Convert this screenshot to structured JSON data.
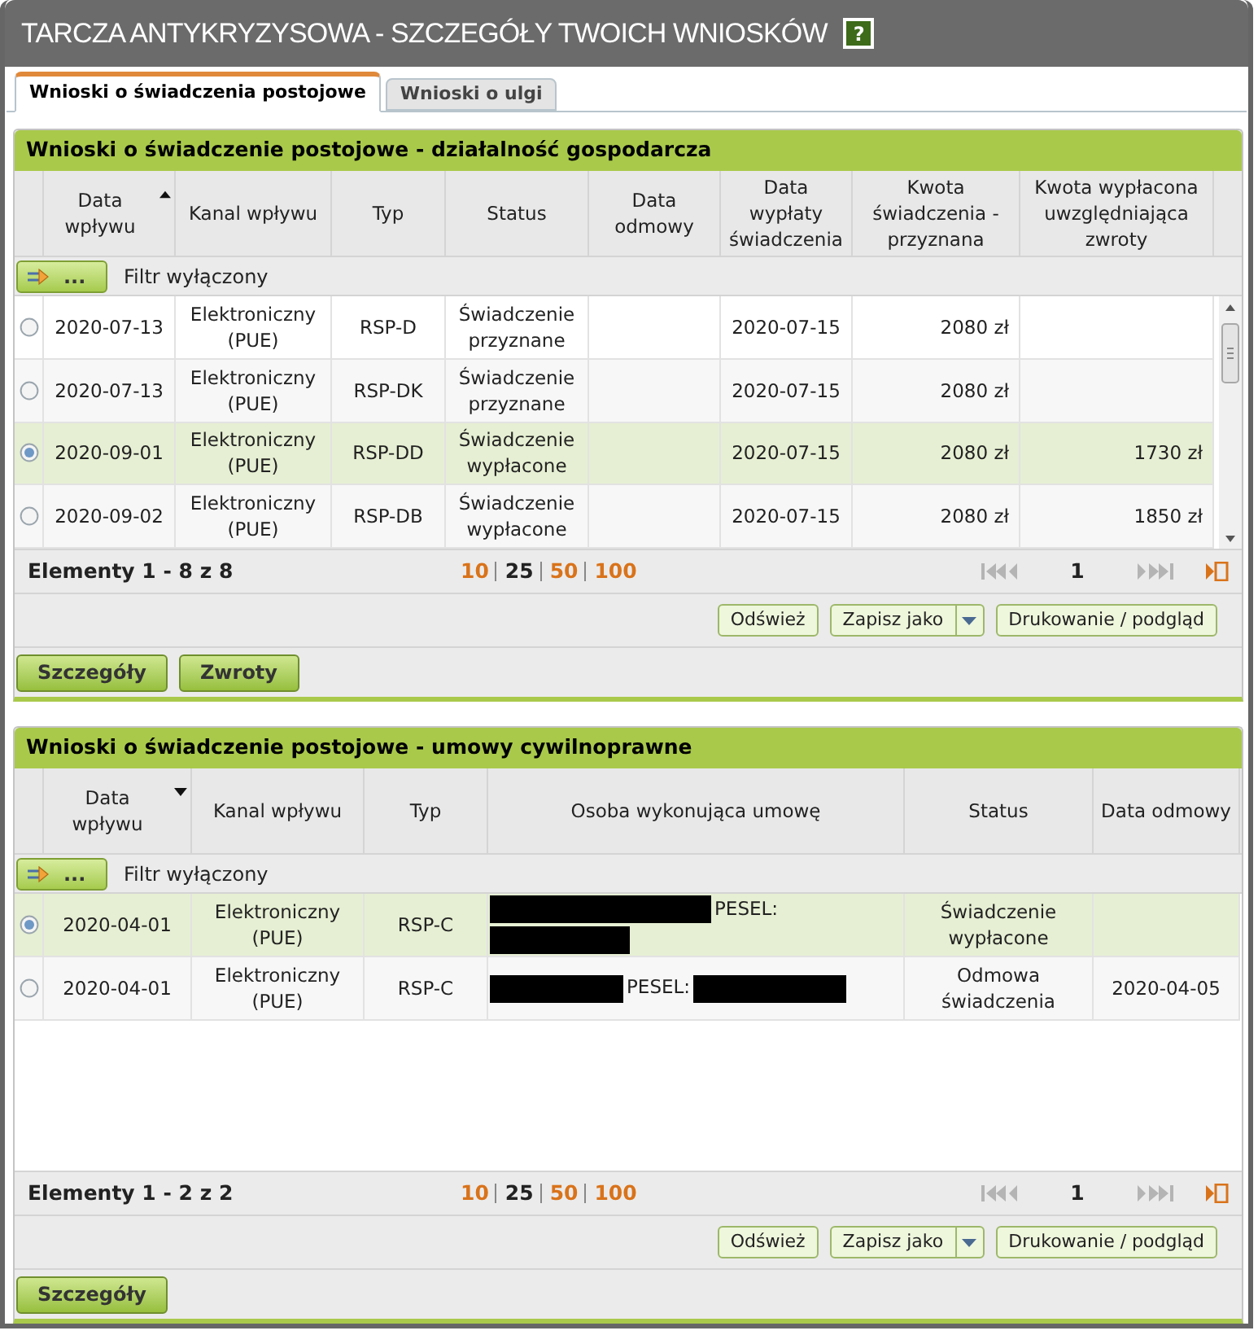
{
  "window": {
    "title": "TARCZA ANTYKRYZYSOWA - SZCZEGÓŁY TWOICH WNIOSKÓW",
    "help_label": "?"
  },
  "tabs": [
    {
      "label": "Wnioski o świadczenia postojowe",
      "selected": true
    },
    {
      "label": "Wnioski o ulgi",
      "selected": false
    }
  ],
  "sections": [
    {
      "title": "Wnioski o świadczenie postojowe - działalność gospodarcza",
      "columns": [
        {
          "label": "Data wpływu",
          "sort_descending": false
        },
        {
          "label": "Kanal wpływu"
        },
        {
          "label": "Typ"
        },
        {
          "label": "Status"
        },
        {
          "label": "Data odmowy"
        },
        {
          "label": "Data wypłaty świadczenia"
        },
        {
          "label": "Kwota świadczenia - przyznana"
        },
        {
          "label": "Kwota wypłacona uwzględniająca zwroty"
        }
      ],
      "filter": {
        "button_label": "...",
        "label": "Filtr wyłączony"
      },
      "scrollbar": true,
      "rows": [
        {
          "selected": false,
          "cells": [
            "2020-07-13",
            "Elektroniczny (PUE)",
            "RSP-D",
            "Świadczenie przyznane",
            null,
            "2020-07-15",
            "2080 zł",
            null
          ]
        },
        {
          "selected": false,
          "cells": [
            "2020-07-13",
            "Elektroniczny (PUE)",
            "RSP-DK",
            "Świadczenie przyznane",
            null,
            "2020-07-15",
            "2080 zł",
            null
          ]
        },
        {
          "selected": true,
          "cells": [
            "2020-09-01",
            "Elektroniczny (PUE)",
            "RSP-DD",
            "Świadczenie wypłacone",
            null,
            "2020-07-15",
            "2080 zł",
            "1730 zł"
          ]
        },
        {
          "selected": false,
          "cells": [
            "2020-09-02",
            "Elektroniczny (PUE)",
            "RSP-DB",
            "Świadczenie wypłacone",
            null,
            "2020-07-15",
            "2080 zł",
            "1850 zł"
          ]
        }
      ],
      "pager": {
        "summary": "Elementy 1 - 8 z 8",
        "page_sizes": [
          {
            "label": "10",
            "selected": false
          },
          {
            "label": "25",
            "selected": true
          },
          {
            "label": "50",
            "selected": false
          },
          {
            "label": "100",
            "selected": false
          }
        ],
        "page": "1",
        "nav_disabled": true
      },
      "actions": [
        {
          "label": "Odśwież",
          "kind": "button"
        },
        {
          "label": "Zapisz jako",
          "kind": "split"
        },
        {
          "label": "Drukowanie / podgląd",
          "kind": "button"
        }
      ],
      "buttons": [
        "Szczegóły",
        "Zwroty"
      ]
    },
    {
      "title": "Wnioski o świadczenie postojowe - umowy cywilnoprawne",
      "columns": [
        {
          "label": "Data wpływu",
          "sort_descending": true
        },
        {
          "label": "Kanal wpływu"
        },
        {
          "label": "Typ"
        },
        {
          "label": "Osoba wykonująca umowę"
        },
        {
          "label": "Status"
        },
        {
          "label": "Data odmowy"
        }
      ],
      "filter": {
        "button_label": "...",
        "label": "Filtr wyłączony"
      },
      "scrollbar": false,
      "rows": [
        {
          "selected": true,
          "cells": [
            "2020-04-01",
            "Elektroniczny (PUE)",
            "RSP-C",
            {
              "kind": "person",
              "parts": [
                {
                  "kind": "redaction"
                },
                {
                  "kind": "text",
                  "text": "PESEL:"
                },
                {
                  "kind": "redaction"
                }
              ]
            },
            "Świadczenie wypłacone",
            null
          ]
        },
        {
          "selected": false,
          "cells": [
            "2020-04-01",
            "Elektroniczny (PUE)",
            "RSP-C",
            {
              "kind": "person",
              "parts": [
                {
                  "kind": "redaction"
                },
                {
                  "kind": "text",
                  "text": "PESEL:"
                },
                {
                  "kind": "redaction"
                }
              ]
            },
            "Odmowa świadczenia",
            "2020-04-05"
          ]
        }
      ],
      "pager": {
        "summary": "Elementy 1 - 2 z 2",
        "page_sizes": [
          {
            "label": "10",
            "selected": false
          },
          {
            "label": "25",
            "selected": true
          },
          {
            "label": "50",
            "selected": false
          },
          {
            "label": "100",
            "selected": false
          }
        ],
        "page": "1",
        "nav_disabled": true
      },
      "actions": [
        {
          "label": "Odśwież",
          "kind": "button"
        },
        {
          "label": "Zapisz jako",
          "kind": "split"
        },
        {
          "label": "Drukowanie / podgląd",
          "kind": "button"
        }
      ],
      "buttons": [
        "Szczegóły"
      ]
    }
  ]
}
